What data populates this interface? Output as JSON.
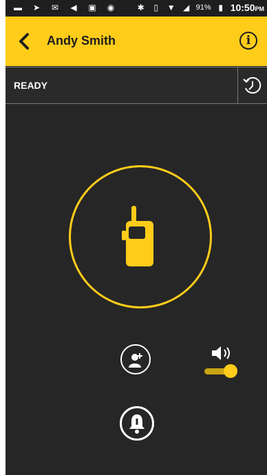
{
  "status_bar": {
    "battery_percent": "91%",
    "time": "10:50",
    "ampm": "PM"
  },
  "header": {
    "title": "Andy Smith"
  },
  "status": {
    "label": "READY"
  },
  "colors": {
    "accent": "#ffcc1a",
    "background": "#262626",
    "header_text": "#1d1d1d"
  },
  "icons": {
    "back": "chevron-left-icon",
    "info": "info-icon",
    "history": "history-icon",
    "radio": "walkie-talkie-icon",
    "add_user": "add-user-icon",
    "speaker": "speaker-icon",
    "alert": "bell-alert-icon"
  },
  "volume": {
    "enabled": true
  }
}
